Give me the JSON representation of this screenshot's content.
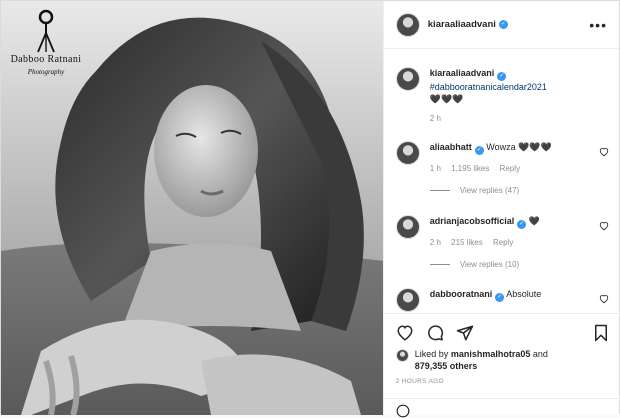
{
  "watermark": {
    "name": "Dabboo Ratnani",
    "subtitle": "Photography"
  },
  "post": {
    "username": "kiaraaliaadvani",
    "more_label": "•••",
    "caption": {
      "username": "kiaraaliaadvani",
      "hashtag": "#dabbooratnanicalendar2021",
      "emoji": "🖤🖤🖤",
      "time": "2 h"
    },
    "comments": [
      {
        "username": "aliaabhatt",
        "text": "Wowza 🖤🖤🖤",
        "time": "1 h",
        "likes": "1,195 likes",
        "reply": "Reply",
        "view_replies": "View replies (47)"
      },
      {
        "username": "adrianjacobsofficial",
        "text": "🖤",
        "time": "2 h",
        "likes": "215 likes",
        "reply": "Reply",
        "view_replies": "View replies (10)"
      },
      {
        "username": "dabbooratnani",
        "text": "Absolute"
      }
    ],
    "likes": {
      "prefix": "Liked by",
      "user": "manishmalhotra05",
      "connector": "and",
      "others": "879,355 others"
    },
    "time_ago": "2 HOURS AGO"
  },
  "icons": {
    "more": "more-options-icon",
    "verified": "verified-badge-icon",
    "like": "heart-icon",
    "comment": "comment-icon",
    "share": "share-icon",
    "save": "bookmark-icon"
  },
  "colors": {
    "verified_blue": "#3897f0",
    "hashtag_blue": "#00376b",
    "secondary_text": "#8e8e8e"
  }
}
